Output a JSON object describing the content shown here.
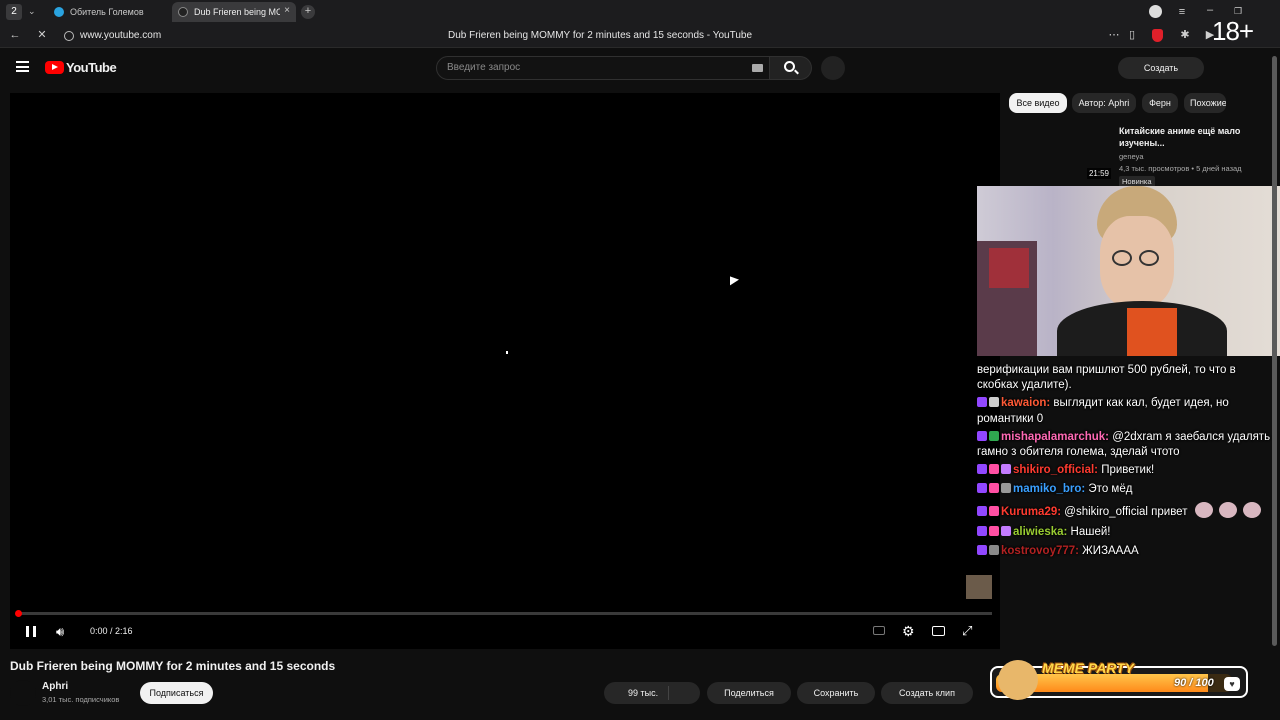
{
  "browser": {
    "tab_count": "2",
    "tabs": [
      {
        "title": "Обитель Големов"
      },
      {
        "title": "Dub Frieren being MOMMY for 2 minutes and 15 seconds"
      }
    ],
    "url": "www.youtube.com",
    "page_title": "Dub Frieren being MOMMY for 2 minutes and 15 seconds - YouTube",
    "age_badge": "18+"
  },
  "youtube": {
    "logo_text": "YouTube",
    "search_placeholder": "Введите запрос",
    "create_label": "Создать",
    "chips": [
      "Все видео",
      "Автор: Aphri",
      "Ферн",
      "Похожие"
    ],
    "recommendation": {
      "title": "Китайские аниме ещё мало изучены...",
      "channel": "geneya",
      "meta": "4,3 тыс. просмотров • 5 дней назад",
      "badge": "Новинка",
      "duration": "21:59"
    },
    "player": {
      "time": "0:00 / 2:16",
      "progress": 0.0
    },
    "video_title": "Dub Frieren being MOMMY for 2 minutes and 15 seconds",
    "channel_name": "Aphri",
    "subscribers": "3,01 тыс. подписчиков",
    "subscribe_label": "Подписаться",
    "likes": "99 тыс.",
    "share_label": "Поделиться",
    "save_label": "Сохранить",
    "clip_label": "Создать клип"
  },
  "chat": {
    "intro_line1": "верификации вам пришлют 500 рублей, то что в",
    "intro_line2": "скобках удалите).",
    "messages": [
      {
        "user": "kawaion:",
        "color": "#ff5a36",
        "text": " выглядит как кал, будет идея, но",
        "cont": "романтики 0"
      },
      {
        "user": "mishapalamarchuk:",
        "color": "#ff69b4",
        "text": " @2dxram я заебался удалять",
        "cont": "гамно з обителя голема, зделай чтото"
      },
      {
        "user": "shikiro_official:",
        "color": "#ff3b30",
        "text": " Приветик!"
      },
      {
        "user": "mamiko_bro:",
        "color": "#3aa0ff",
        "text": " Это мёд"
      },
      {
        "user": "Kuruma29:",
        "color": "#ff3b30",
        "text": " @shikiro_official привет"
      },
      {
        "user": "aliwieska:",
        "color": "#9acd32",
        "text": " Нашей!"
      },
      {
        "user": "kostrovoy777:",
        "color": "#b22222",
        "text": " ЖИЗАААА"
      }
    ]
  },
  "overlay": {
    "meme_title": "MEME PARTY",
    "meme_progress": "90 / 100",
    "meme_level": 0.9
  }
}
